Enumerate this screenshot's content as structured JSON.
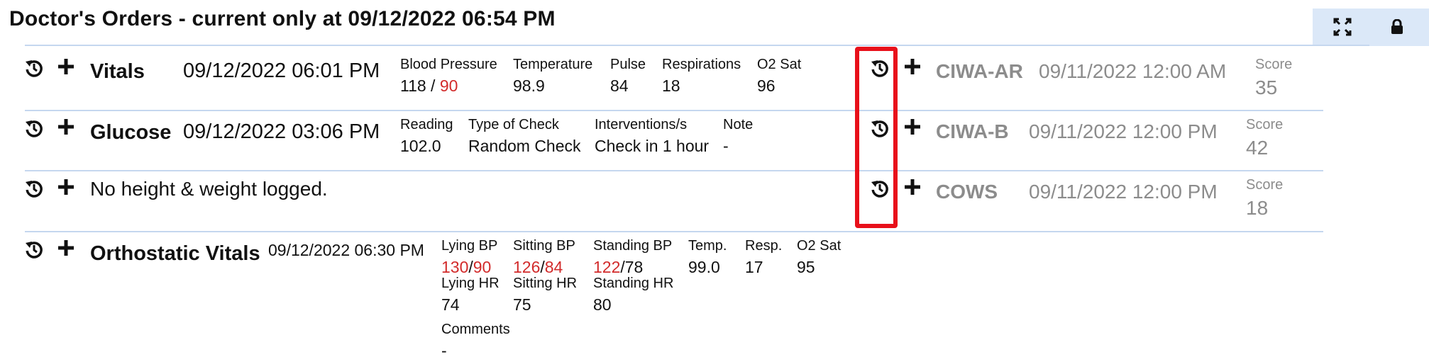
{
  "page": {
    "title": "Doctor's Orders - current only at 09/12/2022 06:54 PM"
  },
  "toolbar": {
    "expand_icon": "expand-icon",
    "lock_icon": "lock-icon"
  },
  "colors": {
    "abnormal": "#d22b2b",
    "muted": "#8c8c8c",
    "divider": "#c5d7ef",
    "panel": "#dbe8f8",
    "highlight": "#e8101a"
  },
  "vitals": {
    "label": "Vitals",
    "datetime": "09/12/2022 06:01 PM",
    "bp_header": "Blood Pressure",
    "bp_systolic": "118",
    "bp_separator": " / ",
    "bp_diastolic": "90",
    "temp_header": "Temperature",
    "temp_value": "98.9",
    "pulse_header": "Pulse",
    "pulse_value": "84",
    "resp_header": "Respirations",
    "resp_value": "18",
    "o2_header": "O2 Sat",
    "o2_value": "96"
  },
  "glucose": {
    "label": "Glucose",
    "datetime": "09/12/2022 03:06 PM",
    "reading_header": "Reading",
    "reading_value": "102.0",
    "type_header": "Type of Check",
    "type_value": "Random Check",
    "interventions_header": "Interventions/s",
    "interventions_value": "Check in 1 hour",
    "note_header": "Note",
    "note_value": "-"
  },
  "height_weight": {
    "text": "No height & weight logged."
  },
  "orthostatic": {
    "label": "Orthostatic Vitals",
    "datetime": "09/12/2022 06:30 PM",
    "lying_bp_header": "Lying BP",
    "lying_bp_sys": "130",
    "lying_bp_dia": "90",
    "sitting_bp_header": "Sitting BP",
    "sitting_bp_sys": "126",
    "sitting_bp_dia": "84",
    "standing_bp_header": "Standing BP",
    "standing_bp_sys": "122",
    "standing_bp_dia": "78",
    "slash": "/",
    "temp_header": "Temp.",
    "temp_value": "99.0",
    "resp_header": "Resp.",
    "resp_value": "17",
    "o2_header": "O2 Sat",
    "o2_value": "95",
    "lying_hr_header": "Lying HR",
    "lying_hr_value": "74",
    "sitting_hr_header": "Sitting HR",
    "sitting_hr_value": "75",
    "standing_hr_header": "Standing HR",
    "standing_hr_value": "80",
    "comments_header": "Comments",
    "comments_value": "-"
  },
  "assessments": [
    {
      "label": "CIWA-AR",
      "datetime": "09/11/2022 12:00 AM",
      "score_header": "Score",
      "score": "35"
    },
    {
      "label": "CIWA-B",
      "datetime": "09/11/2022 12:00 PM",
      "score_header": "Score",
      "score": "42"
    },
    {
      "label": "COWS",
      "datetime": "09/11/2022 12:00 PM",
      "score_header": "Score",
      "score": "18"
    }
  ]
}
